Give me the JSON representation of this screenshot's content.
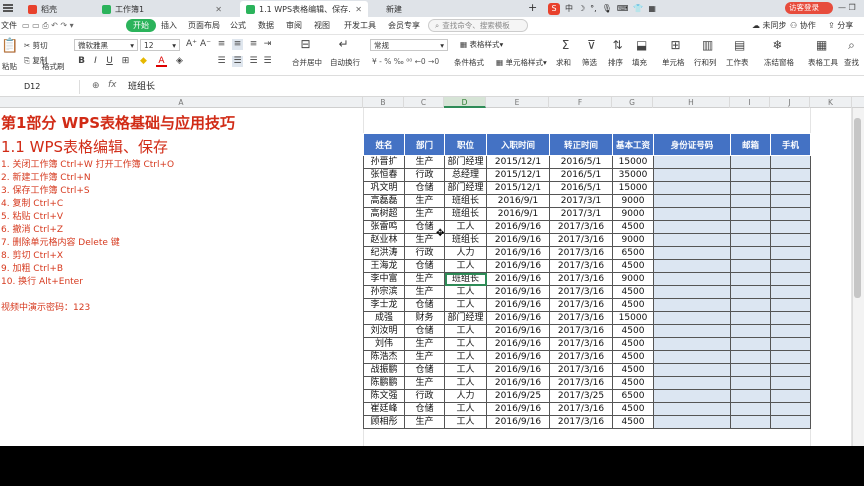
{
  "tabs": [
    {
      "label": "稻壳",
      "color": "#e8412c"
    },
    {
      "label": "工作簿1",
      "color": "#2bb35b"
    },
    {
      "label": "1.1 WPS表格编辑、保存.xlsx",
      "color": "#2bb35b"
    },
    {
      "label": "新建",
      "color": ""
    }
  ],
  "tab_right": {
    "login": "访客登录"
  },
  "menu": {
    "file": "文件",
    "items": [
      "开始",
      "插入",
      "页面布局",
      "公式",
      "数据",
      "审阅",
      "视图",
      "开发工具",
      "会员专享"
    ],
    "search_placeholder": "查找命令、搜索模板",
    "right": [
      "未同步",
      "协作",
      "分享"
    ]
  },
  "toolbar": {
    "clip": [
      "剪切",
      "复制",
      "格式刷"
    ],
    "paste": "粘贴",
    "font_name": "微软雅黑",
    "font_size": "12",
    "font_style": [
      "B",
      "I",
      "U"
    ],
    "align": [
      "合并居中",
      "自动换行"
    ],
    "number_format": "常规",
    "table_style": "表格样式",
    "cond_format": "条件格式",
    "cell_style": "单元格样式",
    "right_groups": [
      "求和",
      "筛选",
      "排序",
      "填充",
      "单元格",
      "行和列",
      "工作表",
      "冻结窗格",
      "表格工具",
      "查找"
    ]
  },
  "formula_bar": {
    "cell_ref": "D12",
    "fx": "fx",
    "value": "班组长"
  },
  "columns": [
    "A",
    "B",
    "C",
    "D",
    "E",
    "F",
    "G",
    "H",
    "I",
    "J",
    "K"
  ],
  "left_text": {
    "title": "第1部分 WPS表格基础与应用技巧",
    "subtitle": "1.1 WPS表格编辑、保存",
    "lines": [
      "1. 关闭工作簿 Ctrl+W   打开工作簿  Ctrl+O",
      "2. 新建工作簿 Ctrl+N",
      "3. 保存工作簿 Ctrl+S",
      "4. 复制 Ctrl+C",
      "5. 粘贴 Ctrl+V",
      "6. 撤消 Ctrl+Z",
      "7. 删除单元格内容 Delete 键",
      "8. 剪切 Ctrl+X",
      "9. 加粗 Ctrl+B",
      "10. 换行  Alt+Enter"
    ],
    "password": "视频中演示密码：123"
  },
  "table": {
    "headers": [
      "姓名",
      "部门",
      "职位",
      "入职时间",
      "转正时间",
      "基本工资",
      "身份证号码",
      "邮箱",
      "手机"
    ],
    "rows": [
      [
        "孙晋扩",
        "生产",
        "部门经理",
        "2015/12/1",
        "2016/5/1",
        "15000"
      ],
      [
        "张恒春",
        "行政",
        "总经理",
        "2015/12/1",
        "2016/5/1",
        "35000"
      ],
      [
        "巩文明",
        "仓储",
        "部门经理",
        "2015/12/1",
        "2016/5/1",
        "15000"
      ],
      [
        "高磊磊",
        "生产",
        "班组长",
        "2016/9/1",
        "2017/3/1",
        "9000"
      ],
      [
        "高树超",
        "生产",
        "班组长",
        "2016/9/1",
        "2017/3/1",
        "9000"
      ],
      [
        "张雷鸣",
        "仓储",
        "工人",
        "2016/9/16",
        "2017/3/16",
        "4500"
      ],
      [
        "赵业林",
        "生产",
        "班组长",
        "2016/9/16",
        "2017/3/16",
        "9000"
      ],
      [
        "纪洪涛",
        "行政",
        "人力",
        "2016/9/16",
        "2017/3/16",
        "6500"
      ],
      [
        "王海龙",
        "仓储",
        "工人",
        "2016/9/16",
        "2017/3/16",
        "4500"
      ],
      [
        "李中富",
        "生产",
        "班组长",
        "2016/9/16",
        "2017/3/16",
        "9000"
      ],
      [
        "孙宗滨",
        "生产",
        "工人",
        "2016/9/16",
        "2017/3/16",
        "4500"
      ],
      [
        "李士龙",
        "仓储",
        "工人",
        "2016/9/16",
        "2017/3/16",
        "4500"
      ],
      [
        "成强",
        "财务",
        "部门经理",
        "2016/9/16",
        "2017/3/16",
        "15000"
      ],
      [
        "刘汝明",
        "仓储",
        "工人",
        "2016/9/16",
        "2017/3/16",
        "4500"
      ],
      [
        "刘伟",
        "生产",
        "工人",
        "2016/9/16",
        "2017/3/16",
        "4500"
      ],
      [
        "陈浩杰",
        "生产",
        "工人",
        "2016/9/16",
        "2017/3/16",
        "4500"
      ],
      [
        "战振鹏",
        "仓储",
        "工人",
        "2016/9/16",
        "2017/3/16",
        "4500"
      ],
      [
        "陈鹏鹏",
        "生产",
        "工人",
        "2016/9/16",
        "2017/3/16",
        "4500"
      ],
      [
        "陈文强",
        "行政",
        "人力",
        "2016/9/25",
        "2017/3/25",
        "6500"
      ],
      [
        "崔廷峰",
        "仓储",
        "工人",
        "2016/9/16",
        "2017/3/16",
        "4500"
      ],
      [
        "顾相彤",
        "生产",
        "工人",
        "2016/9/16",
        "2017/3/16",
        "4500"
      ]
    ],
    "selected": {
      "row": 9,
      "col": 2
    }
  }
}
